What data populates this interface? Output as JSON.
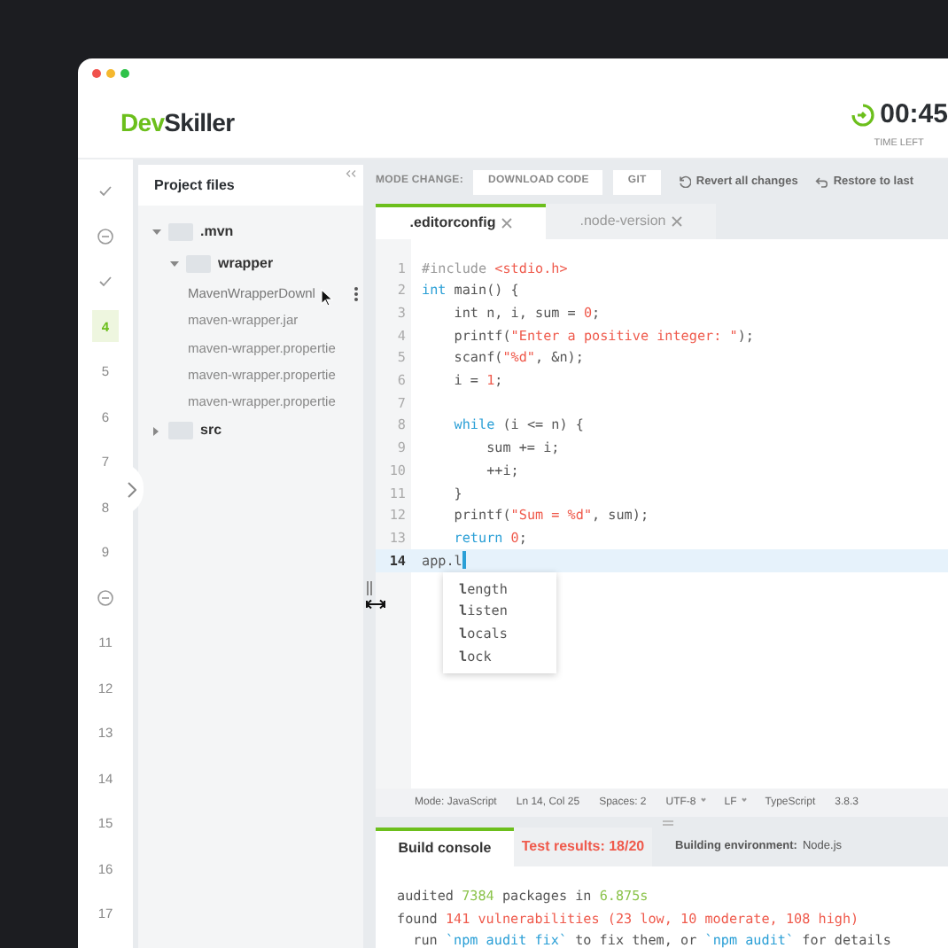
{
  "header": {
    "logo_first": "Dev",
    "logo_second": "Skiller",
    "timer": "00:45",
    "timer_label": "TIME LEFT"
  },
  "questions": [
    {
      "kind": "done",
      "selected": false
    },
    {
      "kind": "skipped",
      "selected": false
    },
    {
      "kind": "done",
      "selected": false
    },
    {
      "kind": "number",
      "label": "4",
      "selected": true
    },
    {
      "kind": "number",
      "label": "5",
      "selected": false
    },
    {
      "kind": "number",
      "label": "6",
      "selected": false
    },
    {
      "kind": "number",
      "label": "7",
      "selected": false
    },
    {
      "kind": "number",
      "label": "8",
      "selected": false
    },
    {
      "kind": "number",
      "label": "9",
      "selected": false
    },
    {
      "kind": "skipped",
      "selected": false
    },
    {
      "kind": "number",
      "label": "11",
      "selected": false
    },
    {
      "kind": "number",
      "label": "12",
      "selected": false
    },
    {
      "kind": "number",
      "label": "13",
      "selected": false
    },
    {
      "kind": "number",
      "label": "14",
      "selected": false
    },
    {
      "kind": "number",
      "label": "15",
      "selected": false
    },
    {
      "kind": "number",
      "label": "16",
      "selected": false
    },
    {
      "kind": "number",
      "label": "17",
      "selected": false
    }
  ],
  "project_files": {
    "title": "Project files",
    "tree": [
      {
        "name": ".mvn",
        "kind": "folder",
        "expanded": true,
        "children": [
          {
            "name": "wrapper",
            "kind": "folder",
            "expanded": true,
            "children": [
              {
                "name": "MavenWrapperDownl",
                "kind": "file",
                "hovered": true
              },
              {
                "name": "maven-wrapper.jar",
                "kind": "file",
                "hovered": false
              },
              {
                "name": "maven-wrapper.propertie",
                "kind": "file",
                "hovered": false
              },
              {
                "name": "maven-wrapper.propertie",
                "kind": "file",
                "hovered": false
              },
              {
                "name": "maven-wrapper.propertie",
                "kind": "file",
                "hovered": false
              }
            ]
          }
        ]
      },
      {
        "name": "src",
        "kind": "folder",
        "expanded": false
      }
    ]
  },
  "toolbar": {
    "mode_label": "MODE CHANGE:",
    "buttons": [
      "DOWNLOAD CODE",
      "GIT"
    ],
    "actions": [
      {
        "kind": "revert",
        "label": "Revert all changes"
      },
      {
        "kind": "restore",
        "label": "Restore to last"
      }
    ]
  },
  "editor_tabs": [
    {
      "label": ".editorconfig",
      "selected": true
    },
    {
      "label": ".node-version",
      "selected": false
    }
  ],
  "code_lines": [
    {
      "number": "1",
      "active": false,
      "tokens": [
        {
          "text": "#include ",
          "kind": "meta"
        },
        {
          "text": "<stdio.h>",
          "kind": "str"
        }
      ]
    },
    {
      "number": "2",
      "active": false,
      "tokens": [
        {
          "text": "int",
          "kind": "kw"
        },
        {
          "text": " main() {",
          "kind": "plain"
        }
      ]
    },
    {
      "number": "3",
      "active": false,
      "tokens": [
        {
          "text": "    int n, i, sum = ",
          "kind": "plain"
        },
        {
          "text": "0",
          "kind": "num"
        },
        {
          "text": ";",
          "kind": "plain"
        }
      ]
    },
    {
      "number": "4",
      "active": false,
      "tokens": [
        {
          "text": "    printf(",
          "kind": "plain"
        },
        {
          "text": "\"Enter a positive integer: \"",
          "kind": "str"
        },
        {
          "text": ");",
          "kind": "plain"
        }
      ]
    },
    {
      "number": "5",
      "active": false,
      "tokens": [
        {
          "text": "    scanf(",
          "kind": "plain"
        },
        {
          "text": "\"%d\"",
          "kind": "str"
        },
        {
          "text": ", &n);",
          "kind": "plain"
        }
      ]
    },
    {
      "number": "6",
      "active": false,
      "tokens": [
        {
          "text": "    i = ",
          "kind": "plain"
        },
        {
          "text": "1",
          "kind": "num"
        },
        {
          "text": ";",
          "kind": "plain"
        }
      ]
    },
    {
      "number": "7",
      "active": false
    },
    {
      "number": "8",
      "active": false,
      "tokens": [
        {
          "text": "    while",
          "kind": "kw"
        },
        {
          "text": " (i <= n) {",
          "kind": "plain"
        }
      ]
    },
    {
      "number": "9",
      "active": false,
      "tokens": [
        {
          "text": "        sum += i;",
          "kind": "plain"
        }
      ]
    },
    {
      "number": "10",
      "active": false,
      "tokens": [
        {
          "text": "        ++i;",
          "kind": "plain"
        }
      ]
    },
    {
      "number": "11",
      "active": false,
      "tokens": [
        {
          "text": "    }",
          "kind": "plain"
        }
      ]
    },
    {
      "number": "12",
      "active": false,
      "tokens": [
        {
          "text": "    printf(",
          "kind": "plain"
        },
        {
          "text": "\"Sum = %d\"",
          "kind": "str"
        },
        {
          "text": ", sum);",
          "kind": "plain"
        }
      ]
    },
    {
      "number": "13",
      "active": false,
      "tokens": [
        {
          "text": "    return ",
          "kind": "kw"
        },
        {
          "text": "0",
          "kind": "num"
        },
        {
          "text": ";",
          "kind": "plain"
        }
      ]
    },
    {
      "number": "14",
      "active": true,
      "tokens": [
        {
          "text": "app.l",
          "kind": "plain"
        }
      ]
    }
  ],
  "autocomplete": [
    "**l**ength",
    "**l**isten",
    "**l**ocals",
    "**l**ock"
  ],
  "status_bar": [
    {
      "text": "Mode: JavaScript",
      "dropdown": false
    },
    {
      "text": "Ln 14, Col 25",
      "dropdown": false
    },
    {
      "text": "Spaces: 2",
      "dropdown": false
    },
    {
      "text": "UTF-8",
      "dropdown": true
    },
    {
      "text": "LF",
      "dropdown": true
    },
    {
      "text": "TypeScript",
      "dropdown": false
    },
    {
      "text": "3.8.3",
      "dropdown": false
    }
  ],
  "bottom_tabs": [
    {
      "kind": "tab",
      "label": "Build console",
      "selected": true
    },
    {
      "kind": "alert",
      "label": "Test results: 18/20",
      "selected": false
    },
    {
      "kind": "info",
      "label": "Building environment:",
      "value": "Node.js"
    }
  ],
  "console": [
    {
      "tokens": [
        {
          "text": "audited ",
          "kind": "plain"
        },
        {
          "text": "7384",
          "kind": "green"
        },
        {
          "text": " packages in ",
          "kind": "plain"
        },
        {
          "text": "6.875s",
          "kind": "green"
        }
      ]
    },
    {
      "tokens": [
        {
          "text": "found ",
          "kind": "plain"
        },
        {
          "text": "141 vulnerabilities (23 low, 10 moderate, 108 high)",
          "kind": "red"
        }
      ]
    },
    {
      "tokens": [
        {
          "text": "  run ",
          "kind": "plain"
        },
        {
          "text": "`npm audit fix`",
          "kind": "blue"
        },
        {
          "text": " to fix them, or ",
          "kind": "plain"
        },
        {
          "text": "`npm audit`",
          "kind": "blue"
        },
        {
          "text": " for details",
          "kind": "plain"
        }
      ]
    }
  ]
}
